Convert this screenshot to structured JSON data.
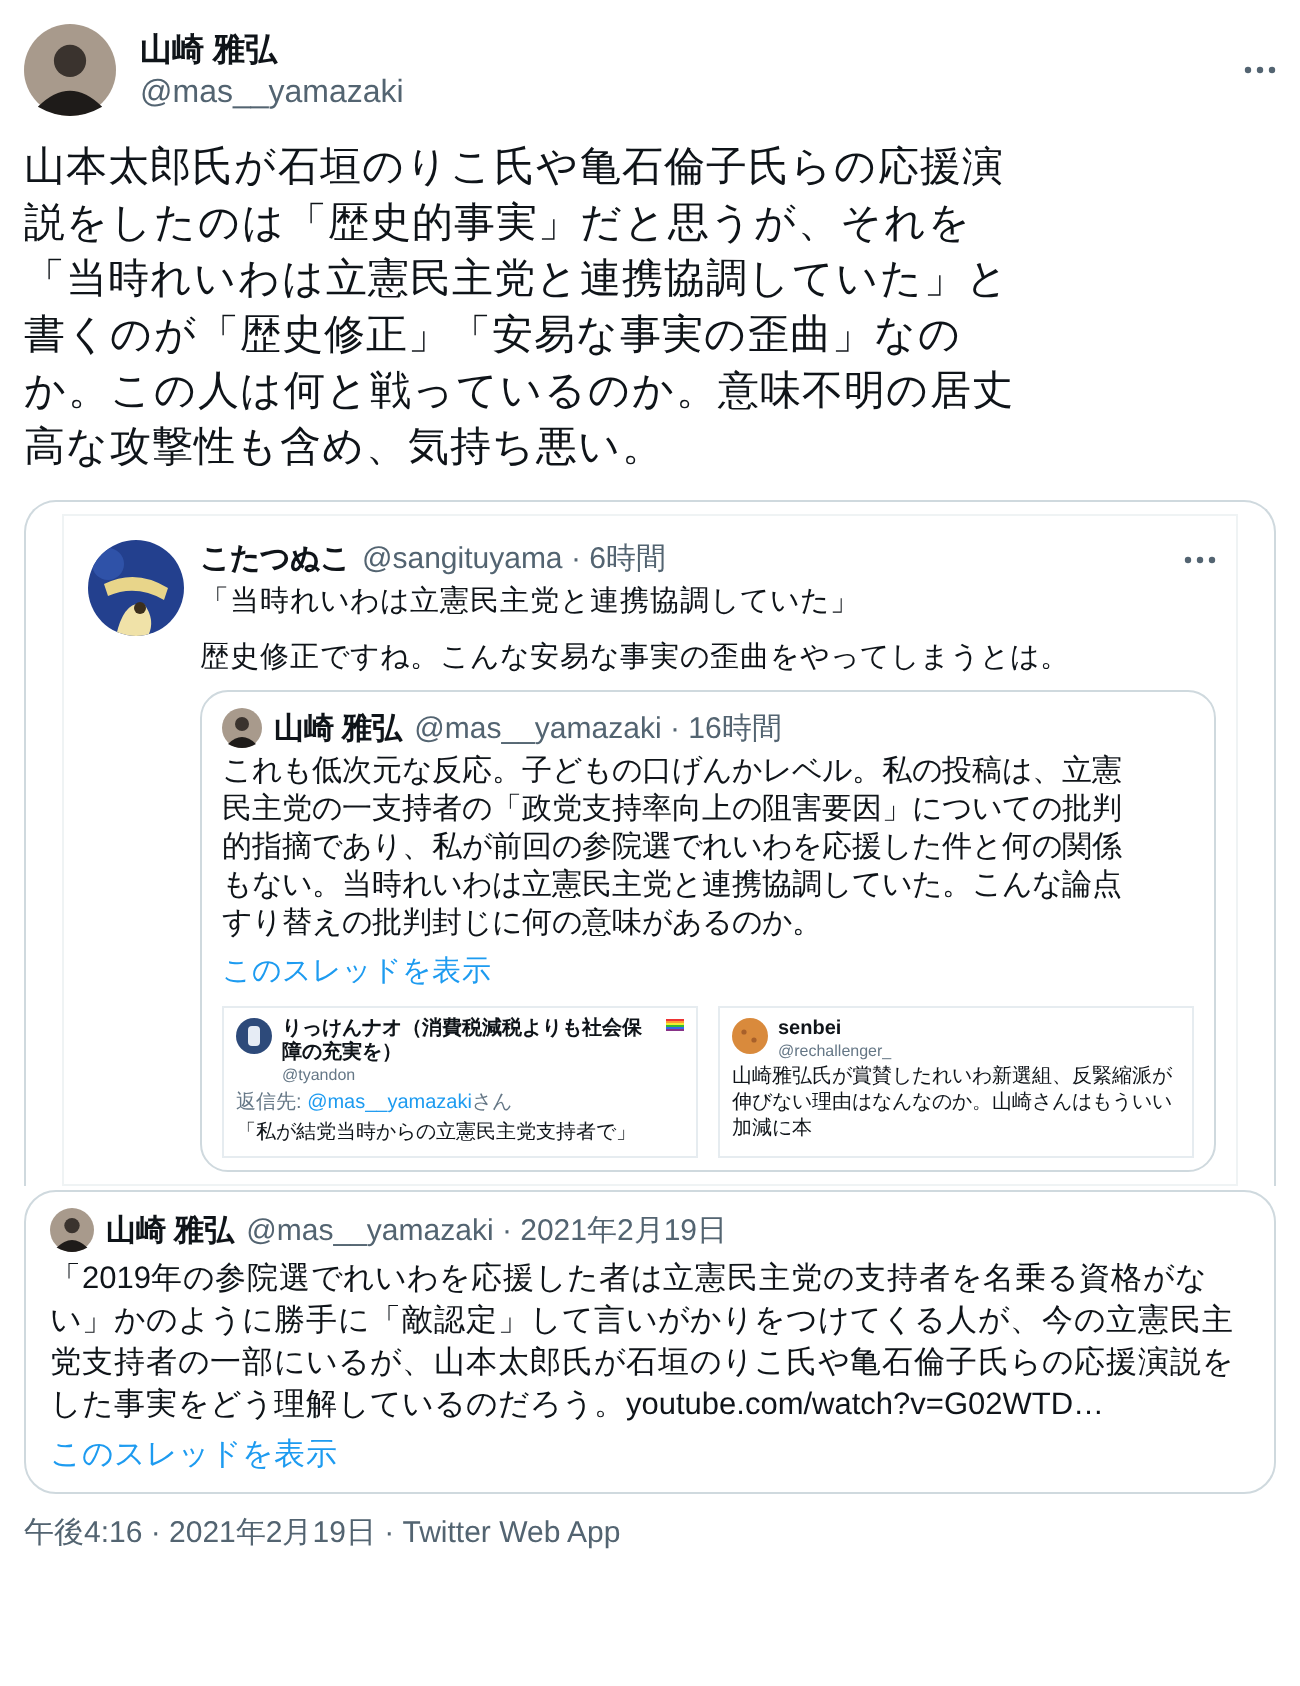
{
  "author": {
    "name": "山崎 雅弘",
    "handle": "@mas__yamazaki"
  },
  "text": "山本太郎氏が石垣のりこ氏や亀石倫子氏らの応援演説をしたのは「歴史的事実」だと思うが、それを「当時れいわは立憲民主党と連携協調していた」と書くのが「歴史修正」「安易な事実の歪曲」なのか。この人は何と戦っているのか。意味不明の居丈高な攻撃性も含め、気持ち悪い。",
  "image": {
    "kind": "screenshot",
    "tweet": {
      "name": "こたつぬこ",
      "handle_time": "@sangituyama · 6時間",
      "lines": [
        "「当時れいわは立憲民主党と連携協調していた」",
        "歴史修正ですね。こんな安易な事実の歪曲をやってしまうとは。"
      ]
    },
    "quoted": {
      "name": "山崎 雅弘",
      "handle_time": "@mas__yamazaki · 16時間",
      "text": "これも低次元な反応。子どもの口げんかレベル。私の投稿は、立憲民主党の一支持者の「政党支持率向上の阻害要因」についての批判的指摘であり、私が前回の参院選でれいわを応援した件と何の関係もない。当時れいわは立憲民主党と連携協調していた。こんな論点すり替えの批判封じに何の意味があるのか。",
      "thread_link": "このスレッドを表示"
    },
    "cards": [
      {
        "name": "りっけんナオ（消費税減税よりも社会保障の充実を）",
        "handle": "@tyandon",
        "reply_prefix": "返信先: ",
        "reply_link": "@mas__yamazaki",
        "reply_suffix": "さん",
        "text": "「私が結党当時からの立憲民主党支持者で」"
      },
      {
        "name": "senbei",
        "handle": "@rechallenger_",
        "text": "山崎雅弘氏が賞賛したれいわ新選組、反緊縮派が伸びない理由はなんなのか。山崎さんはもういい加減に本"
      }
    ]
  },
  "quote": {
    "name": "山崎 雅弘",
    "handle_time": "@mas__yamazaki · 2021年2月19日",
    "text": "「2019年の参院選でれいわを応援した者は立憲民主党の支持者を名乗る資格がない」かのように勝手に「敵認定」して言いがかりをつけてくる人が、今の立憲民主党支持者の一部にいるが、山本太郎氏が石垣のりこ氏や亀石倫子氏らの応援演説をした事実をどう理解しているのだろう。youtube.com/watch?v=G02WTD…",
    "thread_link": "このスレッドを表示"
  },
  "meta": "午後4:16 · 2021年2月19日 · Twitter Web App"
}
